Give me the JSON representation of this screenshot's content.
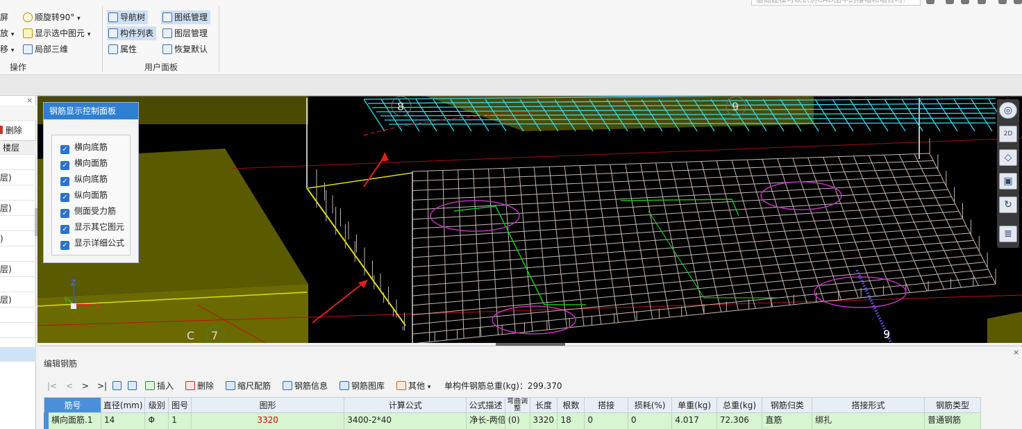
{
  "ribbon": {
    "search_placeholder": "基础建模可以识别CAD图中的楼墙和墙合吗？",
    "group_ops": {
      "title": "操作",
      "items": [
        {
          "label": "屏",
          "icon": "fullscreen-icon"
        },
        {
          "label": "放",
          "icon": "zoom-icon",
          "dropdown": "▾"
        },
        {
          "label": "移",
          "icon": "pan-icon",
          "dropdown": "▾"
        },
        {
          "label": "顺旋转90°",
          "icon": "rotate-icon",
          "dropdown": "▾"
        },
        {
          "label": "显示选中图元",
          "icon": "show-selected-icon",
          "dropdown": "▾"
        },
        {
          "label": "局部三维",
          "icon": "local-3d-icon"
        }
      ]
    },
    "group_user": {
      "title": "用户面板",
      "items": [
        {
          "label": "导航树",
          "icon": "nav-tree-icon",
          "selected": true
        },
        {
          "label": "构件列表",
          "icon": "component-list-icon",
          "selected": true
        },
        {
          "label": "属性",
          "icon": "properties-icon",
          "selected": false
        },
        {
          "label": "图纸管理",
          "icon": "drawing-manage-icon",
          "selected": true
        },
        {
          "label": "图层管理",
          "icon": "layer-manage-icon",
          "selected": false
        },
        {
          "label": "恢复默认",
          "icon": "restore-default-icon",
          "selected": false
        }
      ]
    }
  },
  "left_panel": {
    "close": "×",
    "delete_label": "删除",
    "header": "楼层",
    "rows": [
      "层)",
      "层)",
      ")",
      "层)",
      "层)"
    ]
  },
  "viewport": {
    "axis_labels": {
      "x": "X",
      "y": "Y",
      "z": "Z"
    },
    "grid_labels": [
      "8",
      "9",
      "C",
      "7",
      "9"
    ],
    "rebar_panel": {
      "title": "钢筋显示控制面板",
      "options": [
        {
          "label": "横向底筋",
          "checked": true
        },
        {
          "label": "横向面筋",
          "checked": true
        },
        {
          "label": "纵向底筋",
          "checked": true
        },
        {
          "label": "纵向面筋",
          "checked": true
        },
        {
          "label": "侧面受力筋",
          "checked": true
        },
        {
          "label": "显示其它图元",
          "checked": true
        },
        {
          "label": "显示详细公式",
          "checked": true
        }
      ]
    },
    "nav_buttons": [
      "orbit-icon",
      "2d-view-icon",
      "3d-box-icon",
      "cube-icon",
      "refresh-icon",
      "list-icon"
    ],
    "nav_2d_label": "2D"
  },
  "edit_rebar": {
    "title": "编辑钢筋",
    "close": "×",
    "toolbar": {
      "nav": [
        "|<",
        "<",
        ">",
        ">|"
      ],
      "insert": "插入",
      "delete": "删除",
      "scale_rebar": "缩尺配筋",
      "rebar_info": "钢筋信息",
      "rebar_library": "钢筋图库",
      "other": "其他",
      "other_dropdown": "▾",
      "total_weight": "单构件钢筋总重(kg)：299.370"
    },
    "columns": [
      "筋号",
      "直径(mm)",
      "级别",
      "图号",
      "图形",
      "计算公式",
      "公式描述",
      "弯曲调整",
      "长度",
      "根数",
      "搭接",
      "损耗(%)",
      "单重(kg)",
      "总重(kg)",
      "钢筋归类",
      "搭接形式",
      "钢筋类型"
    ],
    "rows": [
      [
        "横向面筋.1",
        "14",
        "Φ",
        "1",
        "3320",
        "3400-2*40",
        "净长-两倍",
        "(0)",
        "3320",
        "18",
        "0",
        "0",
        "4.017",
        "72.306",
        "直筋",
        "绑扎",
        "普通钢筋"
      ]
    ]
  },
  "colors": {
    "viewport_bg": "#000000",
    "panel_header": "#2f7fd3",
    "row_highlight": "#d6f5d0",
    "rebar_mesh": "#c8b8b0",
    "slab_fill": "#5a5a00",
    "cyan_mesh": "#36d8e8",
    "green_outline": "#20c020",
    "magenta_circle": "#c030c0",
    "red_arrow": "#e02020"
  }
}
